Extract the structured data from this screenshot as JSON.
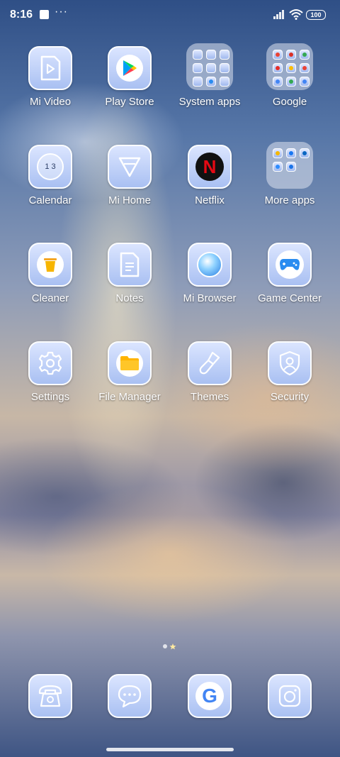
{
  "status_bar": {
    "time": "8:16",
    "more": "···",
    "battery": "100"
  },
  "apps": [
    {
      "label": "Mi Video",
      "icon": "mi-video-icon"
    },
    {
      "label": "Play Store",
      "icon": "play-store-icon"
    },
    {
      "label": "System apps",
      "icon": "system-apps-folder-icon",
      "folder": true
    },
    {
      "label": "Google",
      "icon": "google-folder-icon",
      "folder": true
    },
    {
      "label": "Calendar",
      "icon": "calendar-icon",
      "date_text": "1 3"
    },
    {
      "label": "Mi Home",
      "icon": "mi-home-icon"
    },
    {
      "label": "Netflix",
      "icon": "netflix-icon",
      "glyph": "N"
    },
    {
      "label": "More apps",
      "icon": "more-apps-folder-icon",
      "folder": true
    },
    {
      "label": "Cleaner",
      "icon": "cleaner-icon"
    },
    {
      "label": "Notes",
      "icon": "notes-icon"
    },
    {
      "label": "Mi Browser",
      "icon": "mi-browser-icon"
    },
    {
      "label": "Game Center",
      "icon": "game-center-icon"
    },
    {
      "label": "Settings",
      "icon": "settings-gear-icon"
    },
    {
      "label": "File Manager",
      "icon": "file-manager-icon"
    },
    {
      "label": "Themes",
      "icon": "themes-brush-icon"
    },
    {
      "label": "Security",
      "icon": "security-shield-icon"
    }
  ],
  "dock": [
    {
      "icon": "phone-icon"
    },
    {
      "icon": "messages-icon"
    },
    {
      "icon": "chrome-google-icon",
      "glyph": "G"
    },
    {
      "icon": "camera-icon"
    }
  ],
  "colors": {
    "icon_accent": "#a9c0f2",
    "netflix_red": "#e50914"
  }
}
